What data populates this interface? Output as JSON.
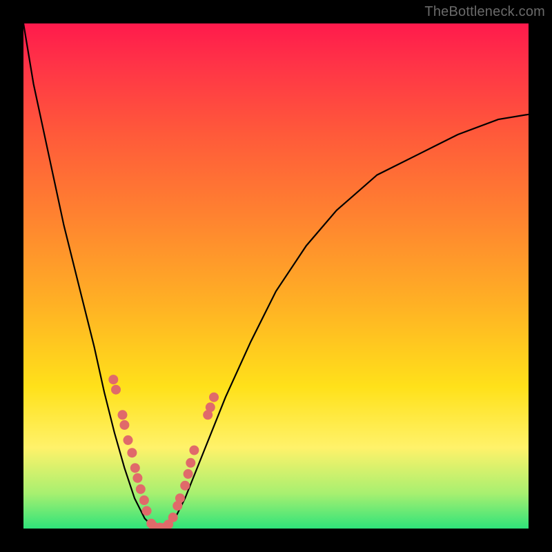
{
  "watermark": "TheBottleneck.com",
  "chart_data": {
    "type": "line",
    "title": "",
    "xlabel": "",
    "ylabel": "",
    "xlim": [
      0,
      1
    ],
    "ylim": [
      0,
      1
    ],
    "series": [
      {
        "name": "curve",
        "x": [
          0.0,
          0.02,
          0.05,
          0.08,
          0.11,
          0.14,
          0.16,
          0.18,
          0.2,
          0.22,
          0.24,
          0.26,
          0.28,
          0.3,
          0.32,
          0.36,
          0.4,
          0.45,
          0.5,
          0.56,
          0.62,
          0.7,
          0.78,
          0.86,
          0.94,
          1.0
        ],
        "y": [
          1.0,
          0.88,
          0.74,
          0.6,
          0.48,
          0.36,
          0.27,
          0.19,
          0.12,
          0.06,
          0.02,
          0.0,
          0.0,
          0.02,
          0.06,
          0.16,
          0.26,
          0.37,
          0.47,
          0.56,
          0.63,
          0.7,
          0.74,
          0.78,
          0.81,
          0.82
        ]
      }
    ],
    "scatter_points": {
      "name": "markers",
      "color": "#e06a6a",
      "points": [
        {
          "x": 0.178,
          "y": 0.295
        },
        {
          "x": 0.183,
          "y": 0.275
        },
        {
          "x": 0.196,
          "y": 0.225
        },
        {
          "x": 0.2,
          "y": 0.205
        },
        {
          "x": 0.207,
          "y": 0.175
        },
        {
          "x": 0.215,
          "y": 0.15
        },
        {
          "x": 0.221,
          "y": 0.12
        },
        {
          "x": 0.226,
          "y": 0.1
        },
        {
          "x": 0.232,
          "y": 0.078
        },
        {
          "x": 0.239,
          "y": 0.056
        },
        {
          "x": 0.244,
          "y": 0.035
        },
        {
          "x": 0.253,
          "y": 0.01
        },
        {
          "x": 0.258,
          "y": 0.004
        },
        {
          "x": 0.27,
          "y": 0.002
        },
        {
          "x": 0.28,
          "y": 0.002
        },
        {
          "x": 0.287,
          "y": 0.008
        },
        {
          "x": 0.296,
          "y": 0.022
        },
        {
          "x": 0.305,
          "y": 0.045
        },
        {
          "x": 0.31,
          "y": 0.06
        },
        {
          "x": 0.32,
          "y": 0.085
        },
        {
          "x": 0.326,
          "y": 0.108
        },
        {
          "x": 0.331,
          "y": 0.13
        },
        {
          "x": 0.338,
          "y": 0.155
        },
        {
          "x": 0.365,
          "y": 0.225
        },
        {
          "x": 0.37,
          "y": 0.24
        },
        {
          "x": 0.377,
          "y": 0.26
        }
      ]
    }
  }
}
